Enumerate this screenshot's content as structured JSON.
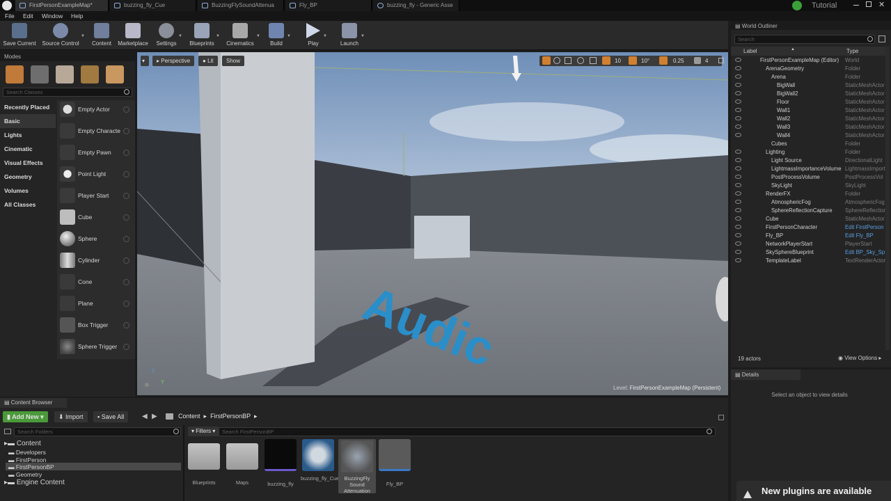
{
  "titlebar": {
    "tabs": [
      "FirstPersonExampleMap*",
      "buzzing_fly_Cue",
      "BuzzingFlySoundAttenua",
      "Fly_BP",
      "buzzing_fly - Generic Asse"
    ],
    "tutorial": "Tutorial"
  },
  "menubar": {
    "items": [
      "File",
      "Edit",
      "Window",
      "Help"
    ]
  },
  "toolbar": {
    "buttons": [
      "Save Current",
      "Source Control",
      "Content",
      "Marketplace",
      "Settings",
      "Blueprints",
      "Cinematics",
      "Build",
      "Play",
      "Launch"
    ]
  },
  "modes": {
    "title": "Modes",
    "search_placeholder": "Search Classes",
    "categories": [
      "Recently Placed",
      "Basic",
      "Lights",
      "Cinematic",
      "Visual Effects",
      "Geometry",
      "Volumes",
      "All Classes"
    ],
    "items": [
      "Empty Actor",
      "Empty Characte",
      "Empty Pawn",
      "Point Light",
      "Player Start",
      "Cube",
      "Sphere",
      "Cylinder",
      "Cone",
      "Plane",
      "Box Trigger",
      "Sphere Trigger"
    ]
  },
  "viewport": {
    "perspective": "Perspective",
    "lit": "Lit",
    "show": "Show",
    "grid_value": "10",
    "rot_value": "10°",
    "scale_value": "0.25",
    "cam_value": "4",
    "floor_text": "Audic",
    "level_label": "Level:",
    "level_name": "FirstPersonExampleMap (Persistent)",
    "axis_z": "Z",
    "axis_y": "Y"
  },
  "outliner": {
    "title": "World Outliner",
    "search_placeholder": "Search",
    "col_label": "Label",
    "col_type": "Type",
    "rows": [
      {
        "label": "FirstPersonExampleMap (Editor)",
        "type": "World"
      },
      {
        "label": "ArenaGeometry",
        "type": "Folder"
      },
      {
        "label": "Arena",
        "type": "Folder"
      },
      {
        "label": "BigWall",
        "type": "StaticMeshActor"
      },
      {
        "label": "BigWall2",
        "type": "StaticMeshActor"
      },
      {
        "label": "Floor",
        "type": "StaticMeshActor"
      },
      {
        "label": "Wall1",
        "type": "StaticMeshActor"
      },
      {
        "label": "Wall2",
        "type": "StaticMeshActor"
      },
      {
        "label": "Wall3",
        "type": "StaticMeshActor"
      },
      {
        "label": "Wall4",
        "type": "StaticMeshActor"
      },
      {
        "label": "Cubes",
        "type": "Folder"
      },
      {
        "label": "Lighting",
        "type": "Folder"
      },
      {
        "label": "Light Source",
        "type": "DirectionalLight"
      },
      {
        "label": "LightmassImportanceVolume",
        "type": "LightmassImport"
      },
      {
        "label": "PostProcessVolume",
        "type": "PostProcessVol"
      },
      {
        "label": "SkyLight",
        "type": "SkyLight"
      },
      {
        "label": "RenderFX",
        "type": "Folder"
      },
      {
        "label": "AtmosphericFog",
        "type": "AtmosphericFog"
      },
      {
        "label": "SphereReflectionCapture",
        "type": "SphereReflection"
      },
      {
        "label": "Cube",
        "type": "StaticMeshActor"
      },
      {
        "label": "FirstPersonCharacter",
        "type": "Edit FirstPerson"
      },
      {
        "label": "Fly_BP",
        "type": "Edit Fly_BP"
      },
      {
        "label": "NetworkPlayerStart",
        "type": "PlayerStart"
      },
      {
        "label": "SkySphereBlueprint",
        "type": "Edit BP_Sky_Sp"
      },
      {
        "label": "TemplateLabel",
        "type": "TextRenderActor"
      }
    ],
    "actor_count": "19 actors",
    "view_options": "View Options"
  },
  "details": {
    "title": "Details",
    "empty_text": "Select an object to view details"
  },
  "content_browser": {
    "title": "Content Browser",
    "add_new": "Add New",
    "import": "Import",
    "save_all": "Save All",
    "path": [
      "Content",
      "FirstPersonBP"
    ],
    "folders_search": "Search Folders",
    "filters": "Filters",
    "assets_search": "Search FirstPersonBP",
    "tree": [
      "Content",
      "Developers",
      "FirstPerson",
      "FirstPersonBP",
      "Geometry",
      "Engine Content"
    ],
    "assets": [
      {
        "name": "Blueprints"
      },
      {
        "name": "Maps"
      },
      {
        "name": "buzzing_fly"
      },
      {
        "name": "buzzing_fly_Cue"
      },
      {
        "name": "BuzzingFly Sound Attenuation"
      },
      {
        "name": "Fly_BP"
      }
    ]
  },
  "notification": {
    "text": "New plugins are available"
  }
}
